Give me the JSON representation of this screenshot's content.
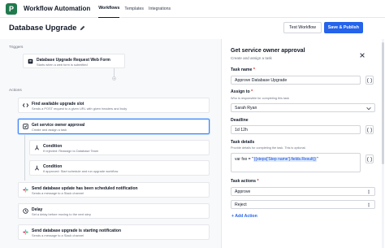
{
  "app": {
    "logo_letter": "P",
    "title": "Workflow Automation",
    "nav": [
      "Workflows",
      "Templates",
      "Integrations"
    ]
  },
  "header": {
    "title": "Database Upgrade",
    "test_label": "Test Workflow",
    "save_label": "Save & Publish"
  },
  "canvas": {
    "triggers_label": "Triggers",
    "actions_label": "Actions",
    "trigger": {
      "title": "Database Upgrade Request Web Form",
      "sub": "Starts when a web form is submitted"
    },
    "nodes": [
      {
        "title": "Find available upgrade slot",
        "sub": "Sends a POST request to a given URL with given headers and body",
        "icon": "code-icon"
      },
      {
        "title": "Get service owner approval",
        "sub": "Create and assign a task",
        "icon": "task-icon"
      },
      {
        "title": "Condition",
        "sub": "If rejected: Reassign to Database Team",
        "icon": "condition-icon"
      },
      {
        "title": "Condition",
        "sub": "If approved: Start schedule and run upgrade workflow",
        "icon": "condition-icon"
      },
      {
        "title": "Send database update has been scheduled notification",
        "sub": "Sends a message to a Slack channel",
        "icon": "slack-icon"
      },
      {
        "title": "Delay",
        "sub": "Set a delay before moving to the next step",
        "icon": "clock-icon"
      },
      {
        "title": "Send database upgrade is starting notification",
        "sub": "Sends a message to a Slack channel",
        "icon": "slack-icon"
      }
    ]
  },
  "panel": {
    "title": "Get service owner approval",
    "subtitle": "Create and assign a task",
    "task_name_label": "Task name",
    "task_name_value": "Approve Database Upgrade",
    "assign_label": "Assign to",
    "assign_help": "Who is responsible for completing this task",
    "assign_value": "Sarah Ryan",
    "deadline_label": "Deadline",
    "deadline_value": "1d 12h",
    "details_label": "Task details",
    "details_help": "Provide details for completing the task. This is optional.",
    "details_prefix": "var foo = \"",
    "details_var": "{{steps['Step name'].fields.Result}}",
    "details_suffix": "\"",
    "actions_label": "Task actions",
    "actions": [
      "Approve",
      "Reject"
    ],
    "add_action_label": "Add Action"
  },
  "colors": {
    "brand": "#1f7a4d",
    "primary": "#2563eb",
    "selected_border": "#3b82f6"
  }
}
